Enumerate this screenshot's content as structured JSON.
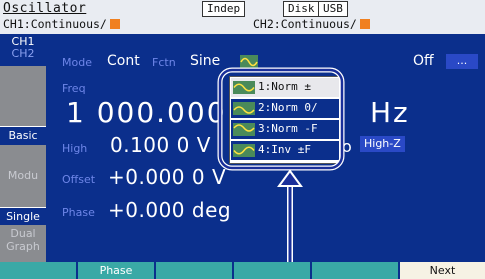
{
  "header": {
    "title": "Oscillator",
    "indep": "Indep",
    "disk": "Disk",
    "usb": "USB",
    "ch1_status": "CH1:Continuous/",
    "ch2_status": "CH2:Continuous/"
  },
  "side_tabs": {
    "ch1": "CH1",
    "ch2": "CH2",
    "basic": "Basic",
    "modu": "Modu",
    "single": "Single",
    "dual": "Dual",
    "graph": "Graph"
  },
  "row_mode": {
    "mode_label": "Mode",
    "mode_value": "Cont",
    "fctn_label": "Fctn",
    "fctn_value": "Sine",
    "off": "Off",
    "more": "..."
  },
  "freq": {
    "label": "Freq",
    "value_left": "1 000.000",
    "unit": "Hz"
  },
  "high": {
    "label": "High",
    "value": "0.100 0 V",
    "suffix": "o",
    "button": "High-Z"
  },
  "offset": {
    "label": "Offset",
    "value": "+0.000 0 V"
  },
  "phase": {
    "label": "Phase",
    "value": "+0.000 deg"
  },
  "popup": {
    "items": [
      {
        "label": "1:Norm ±"
      },
      {
        "label": "2:Norm 0/"
      },
      {
        "label": "3:Norm -F"
      },
      {
        "label": "4:Inv ±F"
      }
    ]
  },
  "bottom_bar": {
    "phase": "Phase",
    "next": "Next"
  },
  "colors": {
    "accent": "#0b2f8c",
    "highlight": "#2a49c6",
    "callout": "#1a2f9a",
    "orange": "#f08020"
  }
}
